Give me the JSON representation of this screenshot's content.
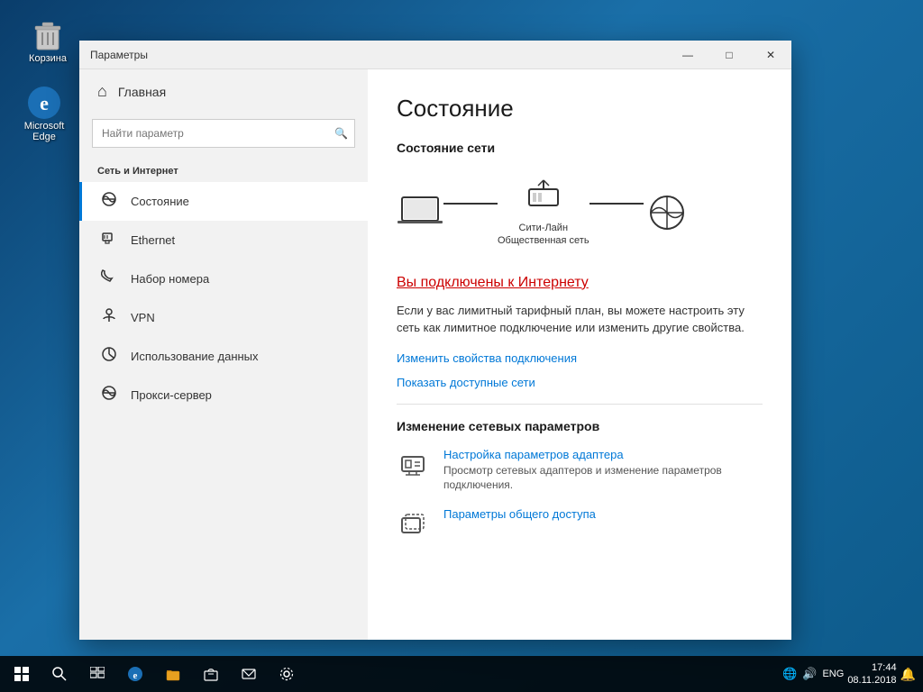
{
  "desktop": {
    "icons": [
      {
        "id": "recycle-bin",
        "label": "Корзина"
      },
      {
        "id": "edge",
        "label": "Microsoft Edge"
      }
    ]
  },
  "taskbar": {
    "start_label": "⊞",
    "search_label": "🔍",
    "task_view": "❑",
    "sys_icons": [
      "🌐",
      "🔊",
      "ENG"
    ],
    "time": "17:44",
    "date": "08.11.2018"
  },
  "window": {
    "title": "Параметры",
    "controls": {
      "minimize": "—",
      "maximize": "□",
      "close": "✕"
    }
  },
  "sidebar": {
    "home_label": "Главная",
    "search_placeholder": "Найти параметр",
    "section_title": "Сеть и Интернет",
    "nav_items": [
      {
        "id": "status",
        "icon": "🌐",
        "label": "Состояние",
        "active": true
      },
      {
        "id": "ethernet",
        "icon": "🖥",
        "label": "Ethernet",
        "active": false
      },
      {
        "id": "dialup",
        "icon": "📞",
        "label": "Набор номера",
        "active": false
      },
      {
        "id": "vpn",
        "icon": "🔒",
        "label": "VPN",
        "active": false
      },
      {
        "id": "data-usage",
        "icon": "📊",
        "label": "Использование данных",
        "active": false
      },
      {
        "id": "proxy",
        "icon": "🌐",
        "label": "Прокси-сервер",
        "active": false
      }
    ]
  },
  "main": {
    "page_title": "Состояние",
    "network_status_title": "Состояние сети",
    "network_diagram": {
      "node_label": "Сити-Лайн\nОбщественная сеть"
    },
    "connected_text": "Вы подключены к Интернету",
    "info_text": "Если у вас лимитный тарифный план, вы можете настроить эту сеть как лимитное подключение или изменить другие свойства.",
    "link_properties": "Изменить свойства подключения",
    "link_networks": "Показать доступные сети",
    "change_settings_title": "Изменение сетевых параметров",
    "settings_items": [
      {
        "id": "adapter-settings",
        "icon": "⚙",
        "title": "Настройка параметров адаптера",
        "desc": "Просмотр сетевых адаптеров и изменение параметров подключения."
      },
      {
        "id": "sharing-settings",
        "icon": "📁",
        "title": "Параметры общего доступа",
        "desc": ""
      }
    ]
  }
}
